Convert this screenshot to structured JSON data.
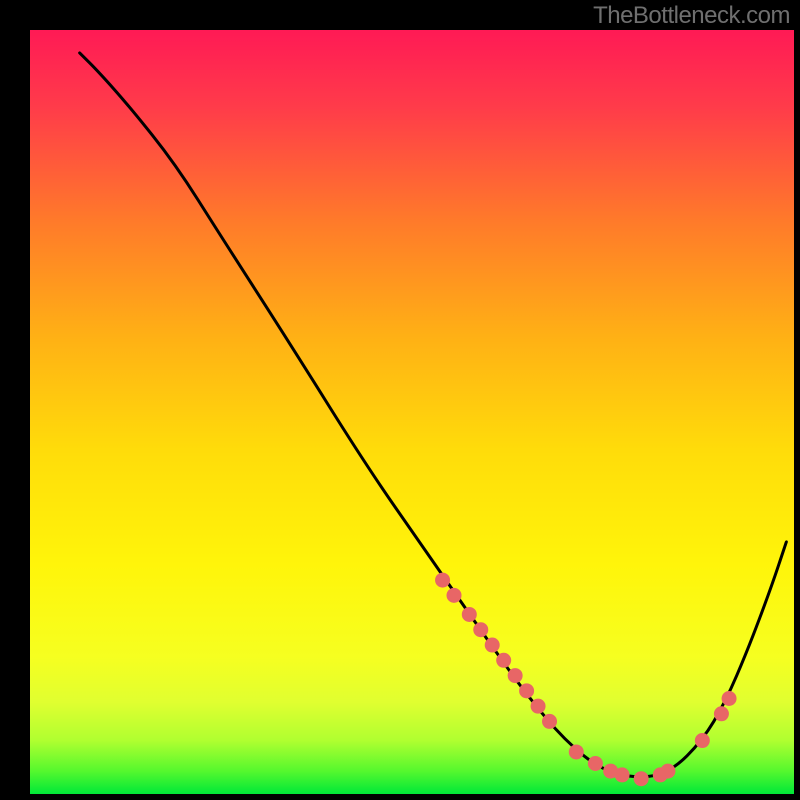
{
  "attribution": "TheBottleneck.com",
  "chart_data": {
    "type": "line",
    "title": "",
    "xlabel": "",
    "ylabel": "",
    "xlim": [
      0,
      100
    ],
    "ylim": [
      0,
      100
    ],
    "grid": false,
    "curve": [
      {
        "x": 6.5,
        "y": 97
      },
      {
        "x": 9,
        "y": 94.5
      },
      {
        "x": 13,
        "y": 90
      },
      {
        "x": 19,
        "y": 82.5
      },
      {
        "x": 25,
        "y": 73
      },
      {
        "x": 34,
        "y": 59
      },
      {
        "x": 44,
        "y": 43
      },
      {
        "x": 52,
        "y": 31.5
      },
      {
        "x": 60,
        "y": 20
      },
      {
        "x": 65,
        "y": 13
      },
      {
        "x": 70,
        "y": 7
      },
      {
        "x": 75,
        "y": 3
      },
      {
        "x": 80,
        "y": 2
      },
      {
        "x": 84,
        "y": 3
      },
      {
        "x": 88,
        "y": 7
      },
      {
        "x": 91,
        "y": 12
      },
      {
        "x": 94,
        "y": 19
      },
      {
        "x": 97,
        "y": 27
      },
      {
        "x": 99,
        "y": 33
      }
    ],
    "markers": [
      {
        "x": 54,
        "y": 28
      },
      {
        "x": 55.5,
        "y": 26
      },
      {
        "x": 57.5,
        "y": 23.5
      },
      {
        "x": 59,
        "y": 21.5
      },
      {
        "x": 60.5,
        "y": 19.5
      },
      {
        "x": 62,
        "y": 17.5
      },
      {
        "x": 63.5,
        "y": 15.5
      },
      {
        "x": 65,
        "y": 13.5
      },
      {
        "x": 66.5,
        "y": 11.5
      },
      {
        "x": 68,
        "y": 9.5
      },
      {
        "x": 71.5,
        "y": 5.5
      },
      {
        "x": 74,
        "y": 4
      },
      {
        "x": 76,
        "y": 3
      },
      {
        "x": 77.5,
        "y": 2.5
      },
      {
        "x": 80,
        "y": 2
      },
      {
        "x": 82.5,
        "y": 2.5
      },
      {
        "x": 83.5,
        "y": 3
      },
      {
        "x": 88,
        "y": 7
      },
      {
        "x": 90.5,
        "y": 10.5
      },
      {
        "x": 91.5,
        "y": 12.5
      }
    ],
    "green_band": {
      "y_bottom": 0.5,
      "y_top": 5
    },
    "colors": {
      "bg_top": "#ff2155",
      "bg_mid": "#ffe000",
      "bg_bottom": "#00f03a",
      "curve": "#000000",
      "marker": "#e86666",
      "border": "#000000"
    }
  }
}
